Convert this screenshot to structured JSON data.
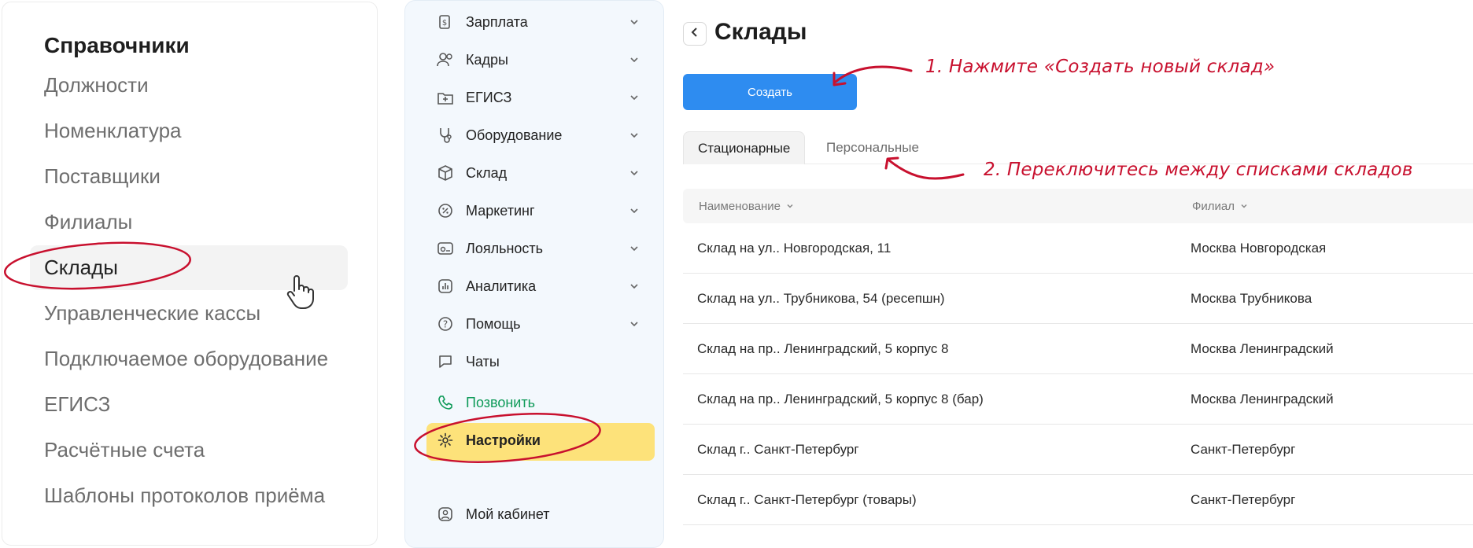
{
  "reference": {
    "title": "Справочники",
    "items": [
      {
        "label": "Должности"
      },
      {
        "label": "Номенклатура"
      },
      {
        "label": "Поставщики"
      },
      {
        "label": "Филиалы"
      },
      {
        "label": "Склады",
        "active": true
      },
      {
        "label": "Управленческие кассы"
      },
      {
        "label": "Подключаемое оборудование"
      },
      {
        "label": "ЕГИСЗ"
      },
      {
        "label": "Расчётные счета"
      },
      {
        "label": "Шаблоны протоколов приёма"
      }
    ]
  },
  "nav": {
    "items": [
      {
        "label": "Зарплата",
        "icon": "salary-icon",
        "has_chevron": true
      },
      {
        "label": "Кадры",
        "icon": "people-icon",
        "has_chevron": true
      },
      {
        "label": "ЕГИСЗ",
        "icon": "folder-plus-icon",
        "has_chevron": true
      },
      {
        "label": "Оборудование",
        "icon": "stethoscope-icon",
        "has_chevron": true
      },
      {
        "label": "Склад",
        "icon": "box-icon",
        "has_chevron": true
      },
      {
        "label": "Маркетинг",
        "icon": "percent-icon",
        "has_chevron": true
      },
      {
        "label": "Лояльность",
        "icon": "loyalty-card-icon",
        "has_chevron": true
      },
      {
        "label": "Аналитика",
        "icon": "chart-icon",
        "has_chevron": true
      },
      {
        "label": "Помощь",
        "icon": "help-icon",
        "has_chevron": true
      },
      {
        "label": "Чаты",
        "icon": "chat-icon",
        "has_chevron": false
      }
    ],
    "call_label": "Позвонить",
    "settings_label": "Настройки",
    "cabinet_label": "Мой кабинет",
    "call_color": "#0e9a58",
    "settings_highlight": "#fde27a"
  },
  "main": {
    "title": "Склады",
    "create_label": "Создать",
    "tabs": [
      {
        "label": "Стационарные",
        "active": true
      },
      {
        "label": "Персональные",
        "active": false
      }
    ],
    "columns": [
      "Наименование",
      "Филиал"
    ],
    "rows": [
      {
        "name": "Склад на ул.. Новгородская, 11",
        "branch": "Москва Новгородская"
      },
      {
        "name": "Склад на ул.. Трубникова, 54 (ресепшн)",
        "branch": "Москва Трубникова"
      },
      {
        "name": "Склад на пр.. Ленинградский, 5 корпус 8",
        "branch": "Москва Ленинградский"
      },
      {
        "name": "Склад на пр.. Ленинградский, 5 корпус 8 (бар)",
        "branch": "Москва Ленинградский"
      },
      {
        "name": "Склад г.. Санкт-Петербург",
        "branch": "Санкт-Петербург"
      },
      {
        "name": "Склад г.. Санкт-Петербург (товары)",
        "branch": "Санкт-Петербург"
      }
    ],
    "accent": "#2e8cf0"
  },
  "annotations": {
    "step1": "1. Нажмите «Создать новый склад»",
    "step2": "2. Переключитесь между списками складов",
    "color": "#c8102e"
  }
}
